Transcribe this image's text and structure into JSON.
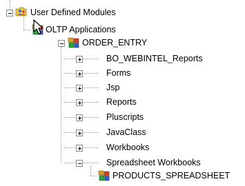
{
  "tree": {
    "root": {
      "label": "User Defined Modules",
      "icon": "folder-users-icon",
      "state": "expanded"
    },
    "app": {
      "label": "OLTP Applications",
      "icon": "puzzle-pieces-icon",
      "state": "expanded"
    },
    "module": {
      "label": "ORDER_ENTRY",
      "icon": "puzzle-pieces-icon",
      "state": "expanded"
    },
    "children": [
      {
        "label": "BO_WEBINTEL_Reports",
        "state": "collapsed"
      },
      {
        "label": "Forms",
        "state": "collapsed"
      },
      {
        "label": "Jsp",
        "state": "collapsed"
      },
      {
        "label": "Reports",
        "state": "collapsed"
      },
      {
        "label": "Pluscripts",
        "state": "collapsed"
      },
      {
        "label": "JavaClass",
        "state": "collapsed"
      },
      {
        "label": "Workbooks",
        "state": "collapsed"
      },
      {
        "label": "Spreadsheet Workbooks",
        "state": "expanded"
      }
    ],
    "leaf": {
      "label": "PRODUCTS_SPREADSHEET",
      "icon": "puzzle-pieces-icon"
    }
  },
  "colors": {
    "tree_line": "#9a9a9a",
    "background": "#ffffff"
  }
}
